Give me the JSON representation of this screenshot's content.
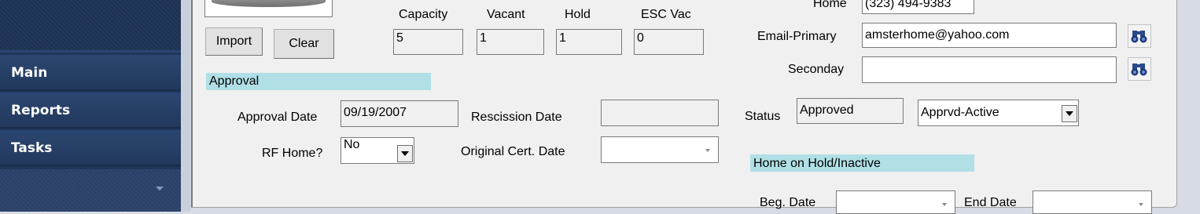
{
  "sidebar": {
    "items": [
      {
        "label": "Main"
      },
      {
        "label": "Reports"
      },
      {
        "label": "Tasks"
      }
    ]
  },
  "photo": {
    "import_label": "Import",
    "clear_label": "Clear"
  },
  "capacity": {
    "headers": [
      "Capacity",
      "Vacant",
      "Hold",
      "ESC Vac"
    ],
    "values": [
      "5",
      "1",
      "1",
      "0"
    ]
  },
  "contact": {
    "home_label": "Home",
    "home_value": "(323) 494-9383",
    "email_primary_label": "Email-Primary",
    "email_primary_value": "amsterhome@yahoo.com",
    "secondary_label": "Seconday",
    "secondary_value": ""
  },
  "approval": {
    "section_title": "Approval",
    "approval_date_label": "Approval Date",
    "approval_date_value": "09/19/2007",
    "rescission_date_label": "Rescission Date",
    "rescission_date_value": "",
    "rf_home_label": "RF Home?",
    "rf_home_value": "No",
    "original_cert_label": "Original Cert. Date",
    "original_cert_value": "",
    "status_label": "Status",
    "status_value": "Approved",
    "status_code_value": "Apprvd-Active"
  },
  "hold": {
    "section_title": "Home on Hold/Inactive",
    "beg_date_label": "Beg. Date",
    "end_date_label": "End Date"
  },
  "colors": {
    "sidebar_bg": "#1f3659",
    "section_header": "#b0e0e6",
    "form_bg": "#f0f0f0"
  }
}
